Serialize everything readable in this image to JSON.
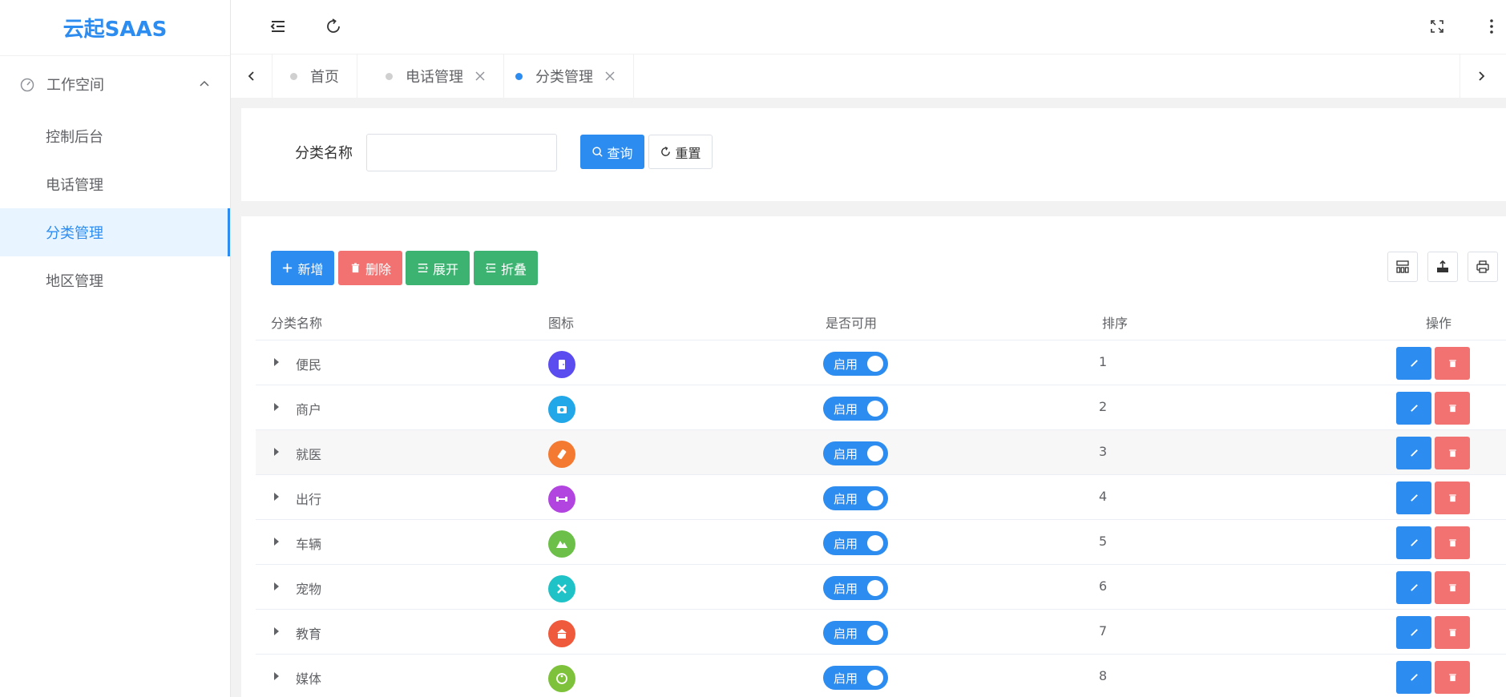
{
  "app": {
    "logo": "云起SAAS"
  },
  "sidebar": {
    "group": {
      "label": "工作空间",
      "icon": "dashboard-icon"
    },
    "items": [
      {
        "label": "控制后台",
        "active": false
      },
      {
        "label": "电话管理",
        "active": false
      },
      {
        "label": "分类管理",
        "active": true
      },
      {
        "label": "地区管理",
        "active": false
      }
    ]
  },
  "tabs": [
    {
      "label": "首页",
      "closable": false,
      "active": false
    },
    {
      "label": "电话管理",
      "closable": true,
      "active": false
    },
    {
      "label": "分类管理",
      "closable": true,
      "active": true
    }
  ],
  "search": {
    "label": "分类名称",
    "value": "",
    "placeholder": "",
    "query_label": "查询",
    "reset_label": "重置"
  },
  "toolbar": {
    "add_label": "新增",
    "delete_label": "删除",
    "expand_label": "展开",
    "fold_label": "折叠"
  },
  "table": {
    "columns": [
      "分类名称",
      "图标",
      "是否可用",
      "排序",
      "操作"
    ],
    "rows": [
      {
        "name": "便民",
        "icon": "door-icon",
        "icon_color": "#5b4cf0",
        "status": "启用",
        "sort": "1"
      },
      {
        "name": "商户",
        "icon": "camera-icon",
        "icon_color": "#22a7e8",
        "status": "启用",
        "sort": "2"
      },
      {
        "name": "就医",
        "icon": "bottle-icon",
        "icon_color": "#f47a32",
        "status": "启用",
        "sort": "3"
      },
      {
        "name": "出行",
        "icon": "dumbbell-icon",
        "icon_color": "#b245e0",
        "status": "启用",
        "sort": "4"
      },
      {
        "name": "车辆",
        "icon": "mountain-icon",
        "icon_color": "#6cc04a",
        "status": "启用",
        "sort": "5"
      },
      {
        "name": "宠物",
        "icon": "tools-icon",
        "icon_color": "#1fc2c7",
        "status": "启用",
        "sort": "6"
      },
      {
        "name": "教育",
        "icon": "building-icon",
        "icon_color": "#f05a3c",
        "status": "启用",
        "sort": "7"
      },
      {
        "name": "媒体",
        "icon": "yinyang-icon",
        "icon_color": "#7dc23a",
        "status": "启用",
        "sort": "8"
      }
    ]
  },
  "colors": {
    "primary": "#2d8cf0",
    "danger": "#f27171",
    "success": "#3cb371"
  }
}
